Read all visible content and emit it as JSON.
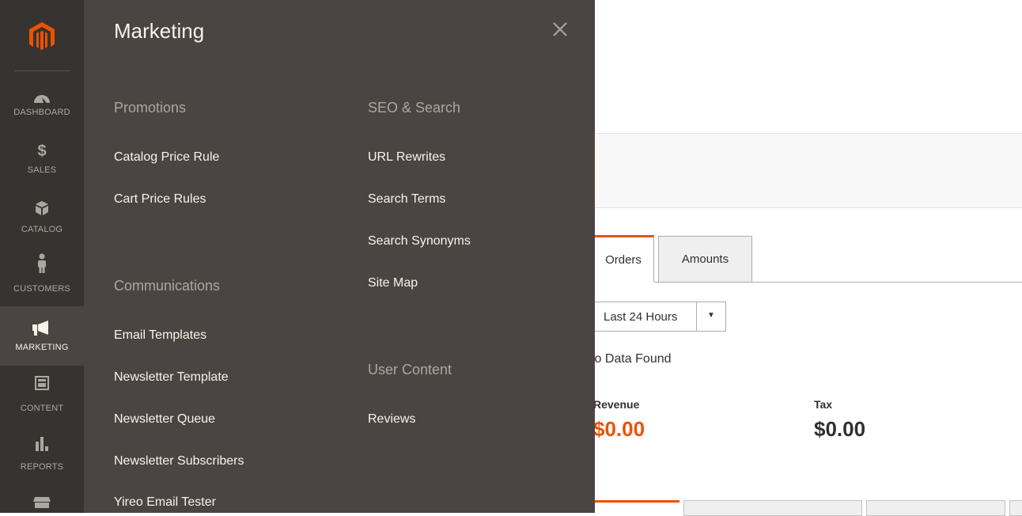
{
  "sidebar": {
    "items": [
      {
        "label": "DASHBOARD",
        "icon": "dashboard-icon"
      },
      {
        "label": "SALES",
        "icon": "dollar-icon"
      },
      {
        "label": "CATALOG",
        "icon": "box-icon"
      },
      {
        "label": "CUSTOMERS",
        "icon": "person-icon"
      },
      {
        "label": "MARKETING",
        "icon": "megaphone-icon"
      },
      {
        "label": "CONTENT",
        "icon": "layout-icon"
      },
      {
        "label": "REPORTS",
        "icon": "bar-chart-icon"
      },
      {
        "label": "",
        "icon": "store-icon"
      }
    ],
    "active": "MARKETING"
  },
  "flyout": {
    "title": "Marketing",
    "groups": {
      "promotions": {
        "title": "Promotions",
        "items": [
          "Catalog Price Rule",
          "Cart Price Rules"
        ]
      },
      "communications": {
        "title": "Communications",
        "items": [
          "Email Templates",
          "Newsletter Template",
          "Newsletter Queue",
          "Newsletter Subscribers",
          "Yireo Email Tester"
        ]
      },
      "seo": {
        "title": "SEO & Search",
        "items": [
          "URL Rewrites",
          "Search Terms",
          "Search Synonyms",
          "Site Map"
        ]
      },
      "user_content": {
        "title": "User Content",
        "items": [
          "Reviews"
        ]
      }
    }
  },
  "dashboard": {
    "tabs": [
      "Orders",
      "Amounts"
    ],
    "period": "Last 24 Hours",
    "no_data": "No Data Found",
    "stats": [
      {
        "label": "Revenue",
        "value": "$0.00",
        "color": "#eb5202"
      },
      {
        "label": "Tax",
        "value": "$0.00",
        "color": "#303030"
      }
    ]
  },
  "colors": {
    "accent": "#eb5202",
    "sidebar": "#373330",
    "flyout": "#4a4542"
  }
}
